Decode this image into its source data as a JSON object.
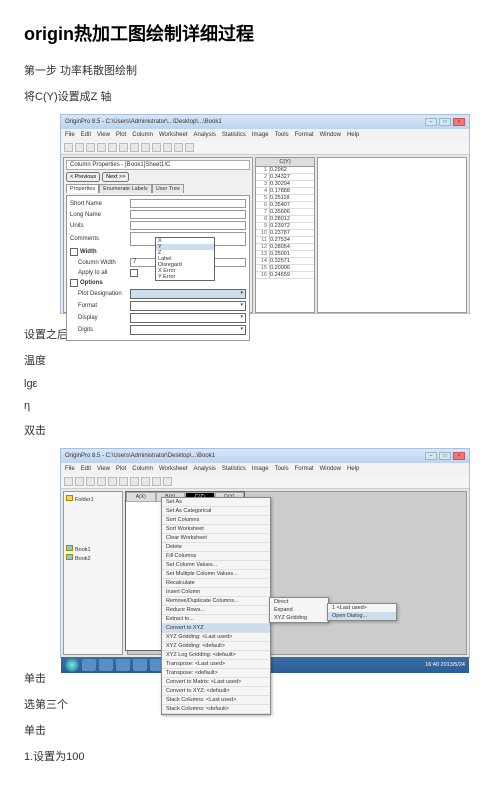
{
  "title": "origin热加工图绘制详细过程",
  "step1": "第一步 功率耗散图绘制",
  "line_setz": "将C(Y)设置成Z 轴",
  "line_after": "设置之后选中Z 轴执行以下操作",
  "line_wendu": "温度",
  "line_lge": "lgε",
  "line_eta": "η",
  "line_dblclick": "双击",
  "line_click": "单击",
  "line_third": "选第三个",
  "line_click2": "单击",
  "line_set100": "1.设置为100",
  "ss1": {
    "wintitle": "OriginPro 8.5 - C:\\Users\\Administrator\\...\\Desktop\\...\\Book1",
    "menus": [
      "File",
      "Edit",
      "View",
      "Plot",
      "Column",
      "Worksheet",
      "Analysis",
      "Statistics",
      "Image",
      "Tools",
      "Format",
      "Window",
      "Help"
    ],
    "dlg_title": "Column Properties - [Book1]Sheet1!C",
    "tabs": [
      "Properties",
      "Enumerate Labels",
      "User Tree"
    ],
    "btn_prev": "< Previous",
    "btn_next": "Next >>",
    "fields": {
      "shortname": "Short Name",
      "longname": "Long Name",
      "units": "Units",
      "comments": "Comments",
      "width": "Width",
      "colwidth": "Column Width",
      "colwidth_val": "7",
      "applyall": "Apply to all",
      "options": "Options",
      "plotdes": "Plot Designation",
      "format": "Format",
      "display": "Display",
      "digits": "Digits"
    },
    "dropdown": [
      "X",
      "Y",
      "Z",
      "Label",
      "Disregard",
      "X Error",
      "Y Error"
    ],
    "datahdr": "C(Y)",
    "data": [
      "0.2962",
      "0.34327",
      "0.30294",
      "0.17888",
      "0.25118",
      "0.35407",
      "0.35606",
      "0.28012",
      "0.23972",
      "0.23787",
      "0.27534",
      "0.28054",
      "0.25001",
      "0.32571",
      "0.20006",
      "0.24659"
    ]
  },
  "ss2": {
    "wintitle": "OriginPro 8.5 - C:\\Users\\Administrator\\Desktop\\...\\Book1",
    "menus": [
      "File",
      "Edit",
      "View",
      "Plot",
      "Column",
      "Worksheet",
      "Analysis",
      "Statistics",
      "Image",
      "Tools",
      "Format",
      "Window",
      "Help"
    ],
    "proj_items": [
      "Folder1",
      "Book1",
      "Book2"
    ],
    "ws_cols": [
      "A(X)",
      "B(Y)",
      "C(Z)",
      "D(Y)"
    ],
    "ctx": [
      "Set As",
      "Set As Categorical",
      "Sort Columns",
      "Sort Worksheet",
      "Clear Worksheet",
      "Delete",
      "Fill Columns",
      "Set Column Values...",
      "Set Multiple Column Values...",
      "Recalculate",
      "Insert Column",
      "Remove/Duplicate Columns...",
      "Reduce Rows...",
      "Extract to...",
      "Convert to XYZ",
      "XYZ Gridding: <Last used>",
      "XYZ Gridding: <default>",
      "XYZ Log Gridding: <default>",
      "Transpose: <Last used>",
      "Transpose: <default>",
      "Convert to Matrix: <Last used>",
      "Convert to XYZ: <default>",
      "Stack Columns: <Last used>",
      "Stack Columns: <default>"
    ],
    "sub1": [
      "Direct",
      "Expand",
      "XYZ Gridding"
    ],
    "sub2": [
      "1 <Last used>",
      "Open Dialog..."
    ],
    "time": "16:40\n2013/5/24"
  }
}
